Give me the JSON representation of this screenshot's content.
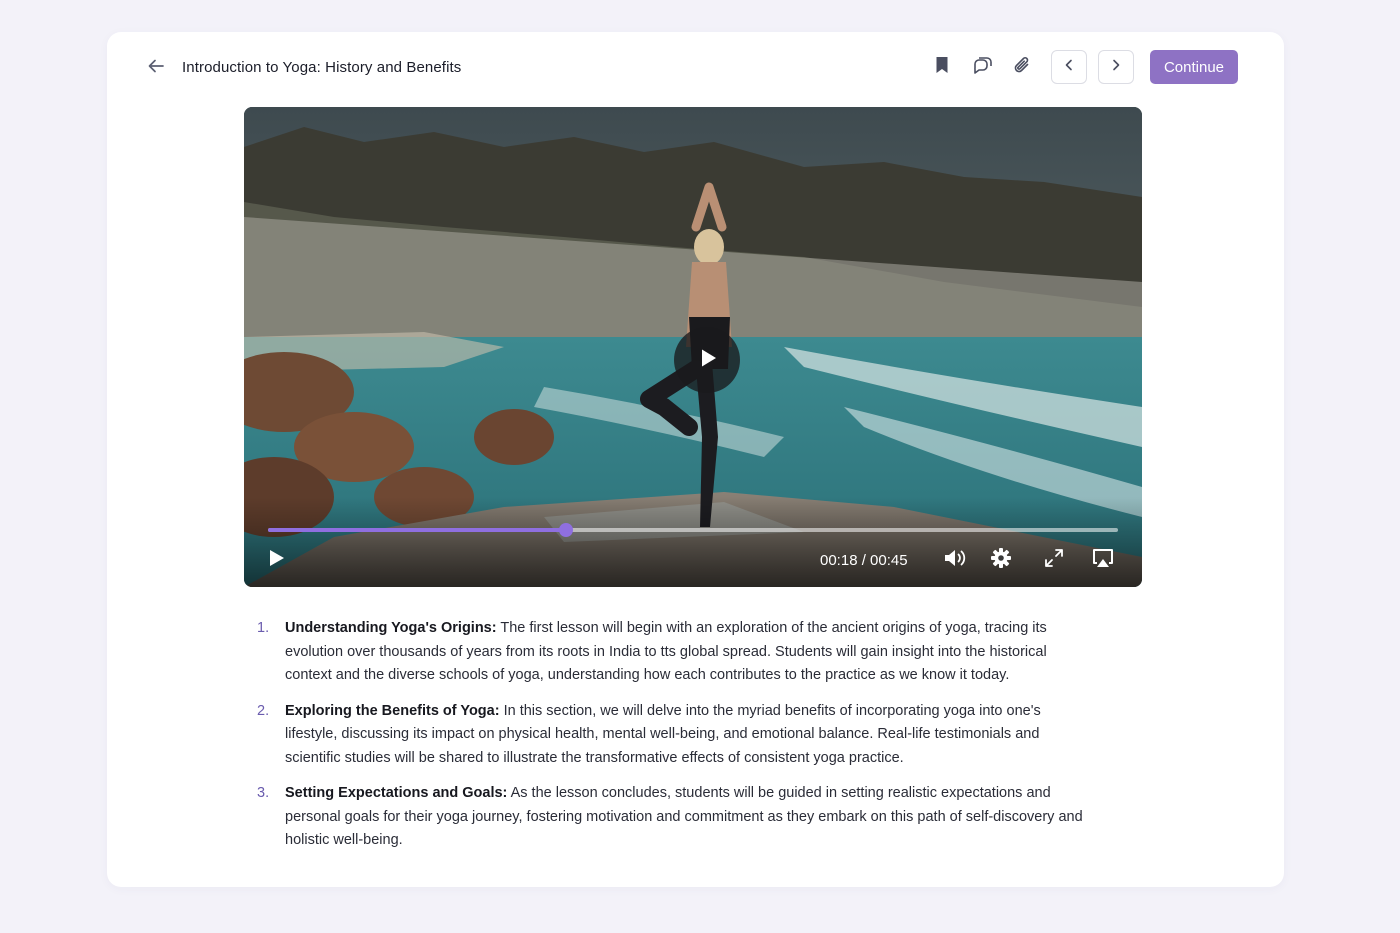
{
  "header": {
    "title": "Introduction to Yoga: History and Benefits",
    "continue_label": "Continue",
    "icons": {
      "back": "arrow-left-icon",
      "bookmark": "bookmark-icon",
      "comments": "comments-icon",
      "attachment": "paperclip-icon",
      "prev": "chevron-left-icon",
      "next": "chevron-right-icon"
    }
  },
  "video": {
    "time_display": "00:18 / 00:45",
    "progress": 0.35,
    "icons": [
      "play-icon",
      "volume-icon",
      "settings-gear-icon",
      "fullscreen-icon",
      "airplay-icon"
    ]
  },
  "lesson": {
    "items": [
      {
        "number": "1.",
        "title": "Understanding Yoga's Origins:",
        "body": " The first lesson will begin with an exploration of the ancient origins of yoga, tracing its evolution over thousands of years from its roots in India to tts global spread. Students will gain insight into the historical context and the diverse schools of yoga, understanding how each contributes to the practice as we know it today."
      },
      {
        "number": "2.",
        "title": "Exploring the Benefits of Yoga:",
        "body": " In this section, we will delve into the myriad benefits of incorporating yoga into one's lifestyle, discussing its impact on physical health, mental well-being, and emotional balance. Real-life testimonials and scientific studies will be shared to illustrate the transformative effects of consistent yoga practice."
      },
      {
        "number": "3.",
        "title": "Setting Expectations and Goals:",
        "body": " As the lesson concludes, students will be guided in setting realistic expectations and personal goals for their yoga journey, fostering motivation and commitment as they embark on this path of self-discovery and holistic well-being."
      }
    ]
  },
  "colors": {
    "accent": "#8e72c4",
    "progress": "#8f6fe0",
    "list_number": "#6a5cae",
    "page_bg": "#f3f2f9"
  }
}
